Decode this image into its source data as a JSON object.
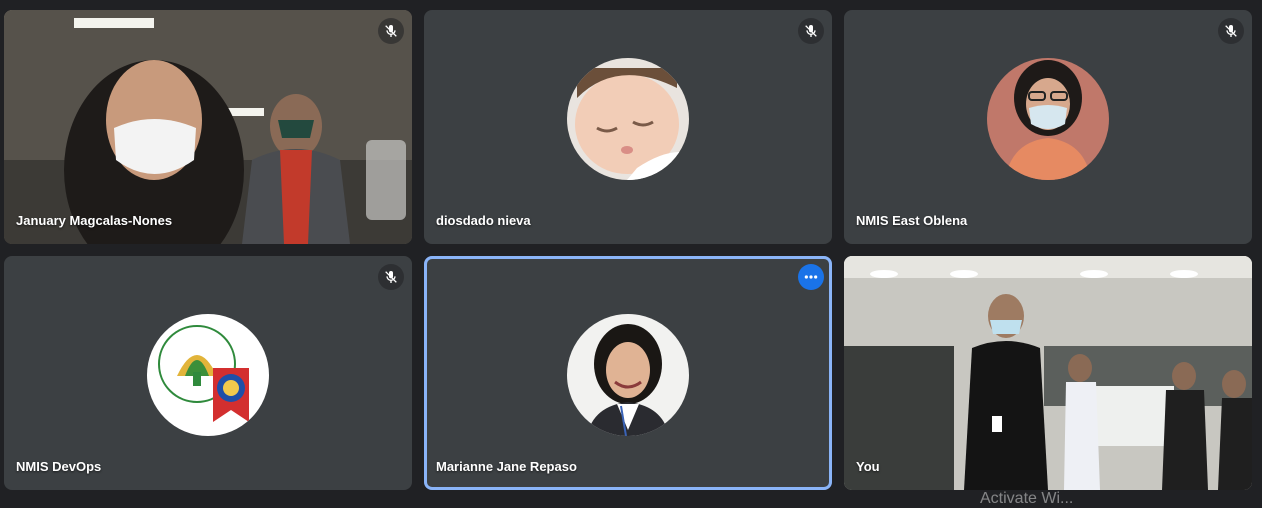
{
  "participants": [
    {
      "name": "January Magcalas-Nones",
      "muted": true,
      "view": "camera"
    },
    {
      "name": "diosdado nieva",
      "muted": true,
      "view": "avatar",
      "avatar_icon": "sleeping-baby-photo"
    },
    {
      "name": "NMIS East Oblena",
      "muted": true,
      "view": "avatar",
      "avatar_icon": "woman-with-mask-photo"
    },
    {
      "name": "NMIS DevOps",
      "muted": true,
      "view": "avatar",
      "avatar_icon": "department-of-agriculture-logo"
    },
    {
      "name": "Marianne Jane Repaso",
      "muted": false,
      "view": "avatar",
      "active_speaker": true,
      "avatar_icon": "woman-portrait-photo"
    },
    {
      "name": "You",
      "muted": false,
      "view": "camera"
    }
  ],
  "colors": {
    "background": "#202124",
    "tile": "#3c4043",
    "active_border": "#8ab4f8",
    "menu_button": "#1a73e8"
  },
  "watermark": "Activate Wi..."
}
